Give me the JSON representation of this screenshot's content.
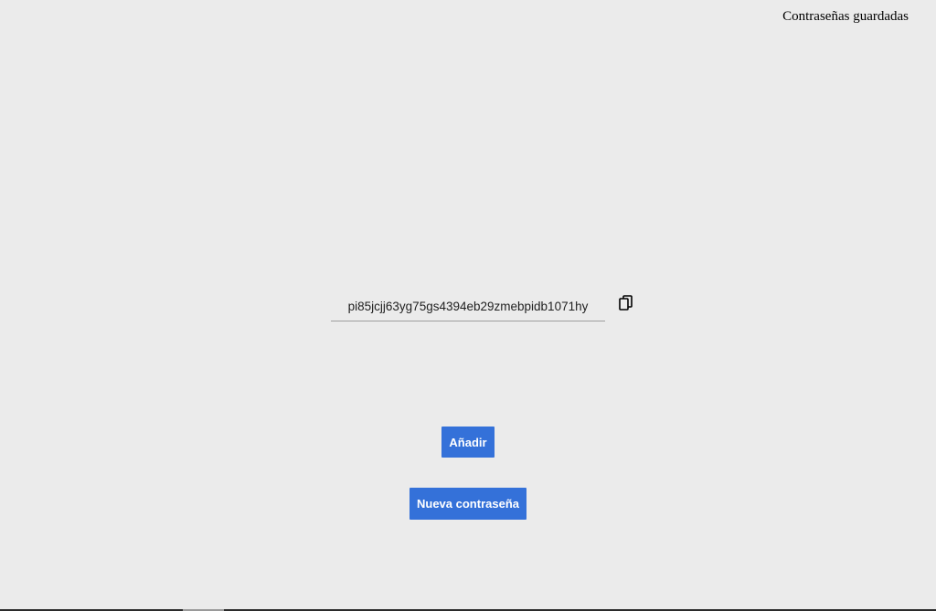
{
  "header": {
    "saved_passwords_label": "Contraseñas guardadas"
  },
  "password": {
    "value": "pi85jcjj63yg75gs4394eb29zmebpidb1071hy",
    "copy_icon": "copy-icon"
  },
  "actions": {
    "add_label": "Añadir",
    "new_password_label": "Nueva contraseña"
  },
  "colors": {
    "background": "#ebebeb",
    "button": "#3471d9",
    "button_text": "#ffffff"
  }
}
